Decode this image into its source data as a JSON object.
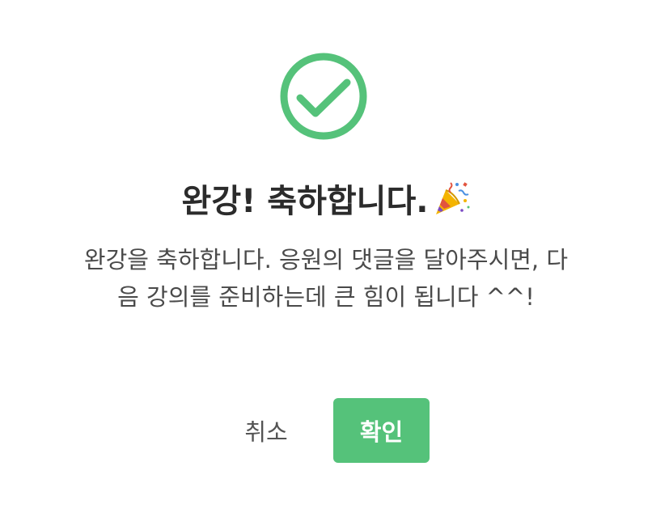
{
  "dialog": {
    "icon": "check-circle-icon",
    "title": "완강! 축하합니다.",
    "title_emoji_icon": "party-popper-icon",
    "message": "완강을 축하합니다. 응원의 댓글을 달아주시면, 다음 강의를 준비하는데 큰 힘이 됩니다 ^^!",
    "cancel_label": "취소",
    "confirm_label": "확인"
  },
  "colors": {
    "accent": "#55c27a",
    "title_text": "#2b2b2b",
    "body_text": "#4a4a4a",
    "background": "#ffffff"
  }
}
